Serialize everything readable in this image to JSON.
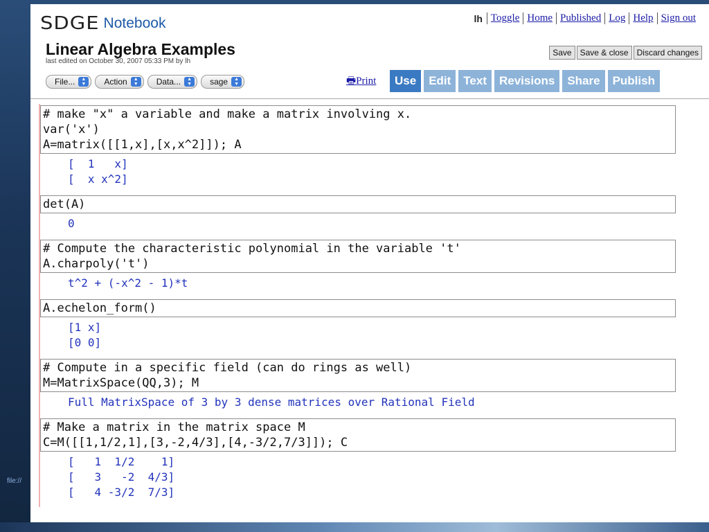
{
  "app": {
    "logo": "SDGE",
    "name": "Notebook"
  },
  "topnav": {
    "user": "lh",
    "links": [
      "Toggle",
      "Home",
      "Published",
      "Log",
      "Help",
      "Sign out"
    ]
  },
  "worksheet": {
    "title": "Linear Algebra Examples",
    "last_edited": "last edited on October 30, 2007 05:33 PM by lh"
  },
  "actions": {
    "save": "Save",
    "save_close": "Save & close",
    "discard": "Discard changes"
  },
  "selects": [
    "File...",
    "Action",
    "Data...",
    "sage"
  ],
  "print_label": "Print",
  "tabs": [
    "Use",
    "Edit",
    "Text",
    "Revisions",
    "Share",
    "Publish"
  ],
  "active_tab": "Use",
  "colors": {
    "accent": "#3a7ac2",
    "tab_inactive": "#8db3d9",
    "output_text": "#2233bb"
  },
  "cells": [
    {
      "input": "# make \"x\" a variable and make a matrix involving x.\nvar('x')\nA=matrix([[1,x],[x,x^2]]); A",
      "output": "[  1   x]\n[  x x^2]"
    },
    {
      "input": "det(A)",
      "output": "0"
    },
    {
      "input": "# Compute the characteristic polynomial in the variable 't'\nA.charpoly('t')",
      "output": "t^2 + (-x^2 - 1)*t"
    },
    {
      "input": "A.echelon_form()",
      "output": "[1 x]\n[0 0]"
    },
    {
      "input": "# Compute in a specific field (can do rings as well)\nM=MatrixSpace(QQ,3); M",
      "output": "Full MatrixSpace of 3 by 3 dense matrices over Rational Field"
    },
    {
      "input": "# Make a matrix in the matrix space M\nC=M([[1,1/2,1],[3,-2,4/3],[4,-3/2,7/3]]); C",
      "output": "[   1  1/2    1]\n[   3   -2  4/3]\n[   4 -3/2  7/3]"
    }
  ],
  "file_link": "file://"
}
